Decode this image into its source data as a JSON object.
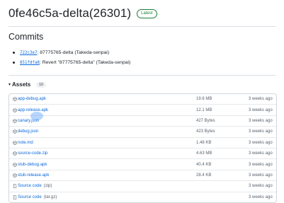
{
  "release": {
    "title": "0fe46c5a-delta(26301)",
    "badge": "Latest"
  },
  "commits": {
    "heading": "Commits",
    "items": [
      {
        "sha": "722c3e7",
        "text": ": 87775765-delta (Takeda-senpai)"
      },
      {
        "sha": "851fdfa8",
        "text": ": Revert \"87775765-delta\" (Takeda-senpai)"
      }
    ]
  },
  "assets": {
    "heading": "Assets",
    "count": "10",
    "rows": [
      {
        "name": "app-debug.apk",
        "size": "19.6 MB",
        "date": "3 weeks ago",
        "icon": "package-icon"
      },
      {
        "name": "app-release.apk",
        "size": "12.1 MB",
        "date": "3 weeks ago",
        "icon": "package-icon"
      },
      {
        "name": "canary.json",
        "size": "427 Bytes",
        "date": "3 weeks ago",
        "icon": "package-icon"
      },
      {
        "name": "debug.json",
        "size": "423 Bytes",
        "date": "3 weeks ago",
        "icon": "package-icon"
      },
      {
        "name": "note.md",
        "size": "1.48 KB",
        "date": "3 weeks ago",
        "icon": "package-icon"
      },
      {
        "name": "source-code.zip",
        "size": "4.63 MB",
        "date": "3 weeks ago",
        "icon": "package-icon"
      },
      {
        "name": "stub-debug.apk",
        "size": "40.4 KB",
        "date": "3 weeks ago",
        "icon": "package-icon"
      },
      {
        "name": "stub-release.apk",
        "size": "28.4 KB",
        "date": "3 weeks ago",
        "icon": "package-icon"
      },
      {
        "name": "Source code",
        "note": "(zip)",
        "size": "",
        "date": "3 weeks ago",
        "icon": "file-zip-icon"
      },
      {
        "name": "Source code",
        "note": "(tar.gz)",
        "size": "",
        "date": "3 weeks ago",
        "icon": "file-zip-icon"
      }
    ]
  },
  "colors": {
    "link": "#0969da",
    "badge_green": "#1a7f37",
    "muted": "#59636e",
    "border": "#d0d7de"
  }
}
